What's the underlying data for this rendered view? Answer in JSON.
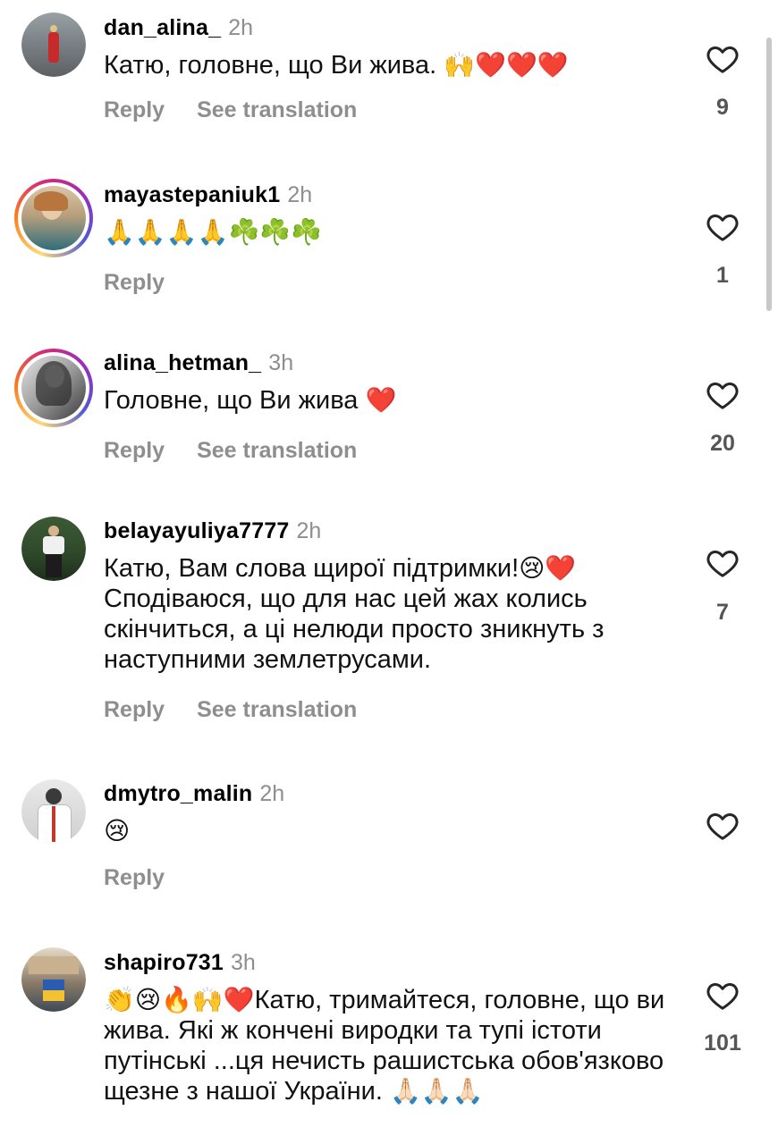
{
  "labels": {
    "reply": "Reply",
    "see_translation": "See translation"
  },
  "icons": {
    "like": "heart-outline-icon",
    "scrollbar": "vertical-scrollbar"
  },
  "colors": {
    "secondary_text": "#8e8e8e",
    "heart": "#e0242f",
    "story_ring": [
      "#feda75",
      "#fa7e1e",
      "#d62976",
      "#962fbf",
      "#4f5bd5"
    ]
  },
  "comments": [
    {
      "username": "dan_alina_",
      "time": "2h",
      "text": "Катю, головне, що Ви жива.",
      "emojis": "🙌❤️❤️❤️",
      "likes": "9",
      "has_translation": true,
      "story_ring": false
    },
    {
      "username": "mayastepaniuk1",
      "time": "2h",
      "text": "",
      "emojis": "🙏🙏🙏🙏☘️☘️☘️",
      "likes": "1",
      "has_translation": false,
      "story_ring": true
    },
    {
      "username": "alina_hetman_",
      "time": "3h",
      "text": "Головне, що Ви жива",
      "emojis": "❤️",
      "likes": "20",
      "has_translation": true,
      "story_ring": true
    },
    {
      "username": "belayayuliya7777",
      "time": "2h",
      "text_line1": "Катю, Вам слова щирої підтримки!",
      "emojis": "😢❤️",
      "text_rest": "Сподіваюся, що для нас цей жах колись скінчиться, а ці нелюди просто зникнуть з наступними землетрусами.",
      "likes": "7",
      "has_translation": true,
      "story_ring": false
    },
    {
      "username": "dmytro_malin",
      "time": "2h",
      "text": "",
      "emojis": "😢",
      "likes": "",
      "has_translation": false,
      "story_ring": false
    },
    {
      "username": "shapiro731",
      "time": "3h",
      "emojis": "👏😢🔥🙌❤️",
      "text": "Катю, тримайтеся, головне, що  ви  жива. Які ж кончені виродки та  тупі істоти путінські ...ця нечисть  рашистська  обов'язково  щезне з нашої України.",
      "emojis_end": "🙏🏻🙏🏻🙏🏻",
      "likes": "101",
      "has_translation": false,
      "story_ring": false
    }
  ]
}
